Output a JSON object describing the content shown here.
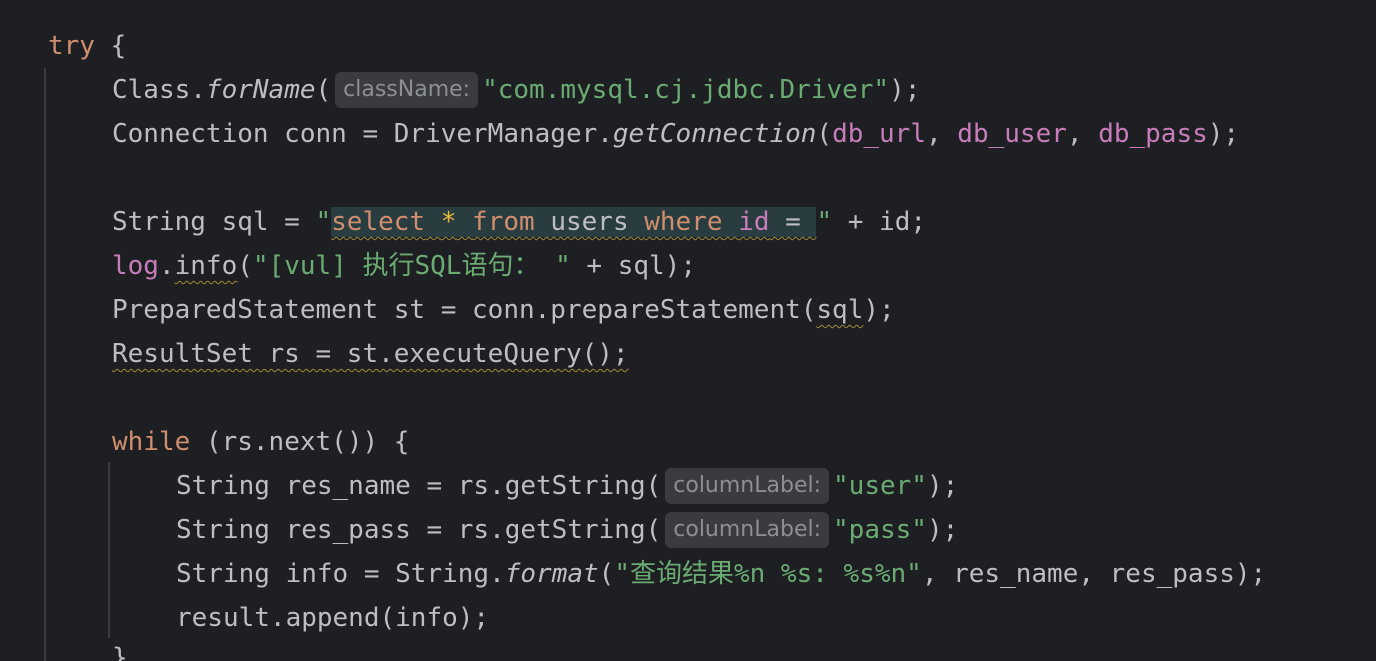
{
  "code": {
    "try_kw": "try",
    "open_brace": " {",
    "l2": {
      "cls": "Class.",
      "method": "forName",
      "paren": "(",
      "hint": "className:",
      "str": "\"com.mysql.cj.jdbc.Driver\"",
      "end": ");"
    },
    "l3": {
      "a": "Connection conn = DriverManager.",
      "method": "getConnection",
      "paren": "(",
      "f1": "db_url",
      "c1": ", ",
      "f2": "db_user",
      "c2": ", ",
      "f3": "db_pass",
      "end": ");"
    },
    "l5": {
      "a": "String sql = ",
      "q": "\"",
      "s1": "select",
      "sp1": " ",
      "star": "*",
      "sp2": " ",
      "s2": "from",
      "sp3": " users ",
      "s3": "where",
      "sp4": " ",
      "s4": "id",
      "sp5": " = ",
      "q2": "\"",
      "end": " + id;"
    },
    "l6": {
      "log": "log",
      "dot": ".",
      "info": "info",
      "paren": "(",
      "str": "\"[vul] 执行SQL语句： \"",
      "end": " + sql);"
    },
    "l7": {
      "a": "PreparedStatement st = conn.prepareStatement(",
      "sql": "sql",
      "end": ");"
    },
    "l8": {
      "a": "ResultSet rs = st.executeQuery();"
    },
    "l10": {
      "kw": "while",
      "rest": " (rs.next()) {"
    },
    "l11": {
      "a": "String res_name = rs.getString(",
      "hint": "columnLabel:",
      "str": "\"user\"",
      "end": ");"
    },
    "l12": {
      "a": "String res_pass = rs.getString(",
      "hint": "columnLabel:",
      "str": "\"pass\"",
      "end": ");"
    },
    "l13": {
      "a": "String info = String.",
      "method": "format",
      "paren": "(",
      "str": "\"查询结果%n %s: %s%n\"",
      "end": ", res_name, res_pass);"
    },
    "l14": {
      "a": "result.append(info);"
    },
    "l15": {
      "a": "}"
    }
  },
  "colors": {
    "background": "#1e1f22",
    "keyword": "#cf8e6d",
    "string": "#6aab73",
    "field": "#c77dba",
    "text": "#bcbec4",
    "hint_bg": "#393b40",
    "selection": "#293c40"
  }
}
